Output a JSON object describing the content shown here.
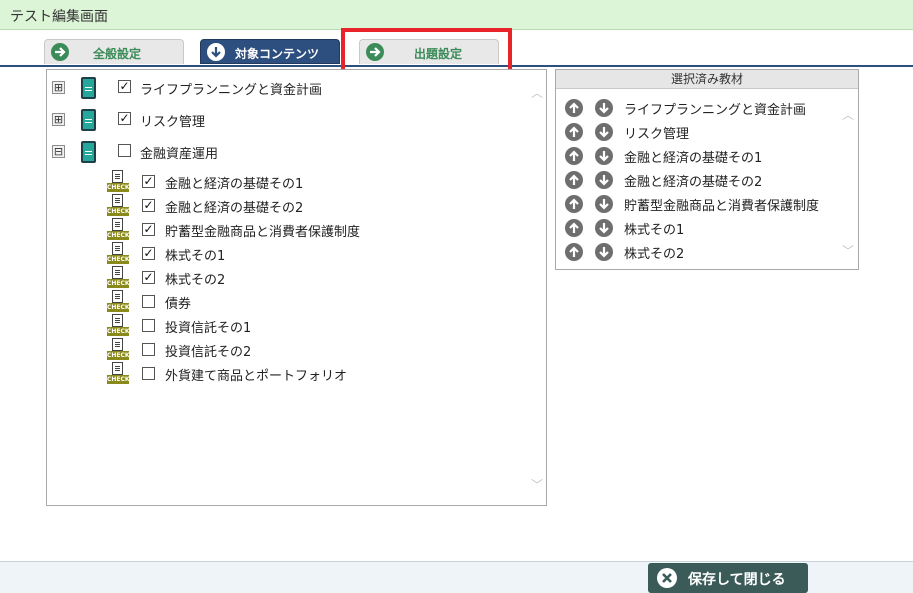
{
  "window": {
    "title": "テスト編集画面"
  },
  "tabs": [
    {
      "label": "全般設定",
      "state": "inactive",
      "icon": "arrow-right-icon"
    },
    {
      "label": "対象コンテンツ",
      "state": "active",
      "icon": "arrow-down-icon"
    },
    {
      "label": "出題設定",
      "state": "inactive",
      "icon": "arrow-right-icon"
    }
  ],
  "tree": {
    "groups": [
      {
        "label": "ライフプランニングと資金計画",
        "expander": "⊞",
        "checked": true
      },
      {
        "label": "リスク管理",
        "expander": "⊞",
        "checked": true
      },
      {
        "label": "金融資産運用",
        "expander": "⊟",
        "checked": false
      }
    ],
    "children": [
      {
        "label": "金融と経済の基礎その1",
        "checked": true
      },
      {
        "label": "金融と経済の基礎その2",
        "checked": true
      },
      {
        "label": "貯蓄型金融商品と消費者保護制度",
        "checked": true
      },
      {
        "label": "株式その1",
        "checked": true
      },
      {
        "label": "株式その2",
        "checked": true
      },
      {
        "label": "債券",
        "checked": false
      },
      {
        "label": "投資信託その1",
        "checked": false
      },
      {
        "label": "投資信託その2",
        "checked": false
      },
      {
        "label": "外貨建て商品とポートフォリオ",
        "checked": false
      }
    ],
    "check_badge": "CHECK"
  },
  "selected": {
    "header": "選択済み教材",
    "items": [
      "ライフプランニングと資金計画",
      "リスク管理",
      "金融と経済の基礎その1",
      "金融と経済の基礎その2",
      "貯蓄型金融商品と消費者保護制度",
      "株式その1",
      "株式その2"
    ]
  },
  "footer": {
    "save_close_label": "保存して閉じる"
  },
  "colors": {
    "active_tab": "#2d4f7f",
    "inactive_tab_text": "#3c8c59",
    "highlight": "#e8232a",
    "save_button": "#3a5b58",
    "title_bar": "#ddf5d7"
  }
}
